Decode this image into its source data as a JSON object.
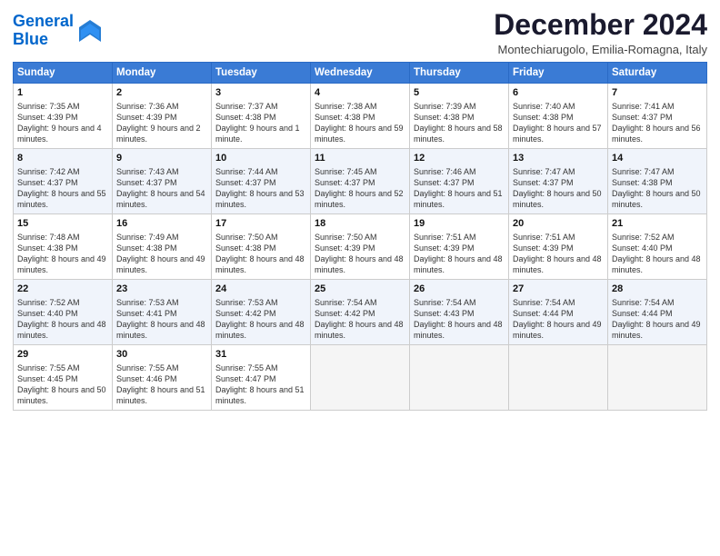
{
  "header": {
    "logo_line1": "General",
    "logo_line2": "Blue",
    "month_title": "December 2024",
    "location": "Montechiarugolo, Emilia-Romagna, Italy"
  },
  "days_of_week": [
    "Sunday",
    "Monday",
    "Tuesday",
    "Wednesday",
    "Thursday",
    "Friday",
    "Saturday"
  ],
  "weeks": [
    [
      {
        "day": 1,
        "sunrise": "7:35 AM",
        "sunset": "4:39 PM",
        "daylight": "9 hours and 4 minutes."
      },
      {
        "day": 2,
        "sunrise": "7:36 AM",
        "sunset": "4:39 PM",
        "daylight": "9 hours and 2 minutes."
      },
      {
        "day": 3,
        "sunrise": "7:37 AM",
        "sunset": "4:38 PM",
        "daylight": "9 hours and 1 minute."
      },
      {
        "day": 4,
        "sunrise": "7:38 AM",
        "sunset": "4:38 PM",
        "daylight": "8 hours and 59 minutes."
      },
      {
        "day": 5,
        "sunrise": "7:39 AM",
        "sunset": "4:38 PM",
        "daylight": "8 hours and 58 minutes."
      },
      {
        "day": 6,
        "sunrise": "7:40 AM",
        "sunset": "4:38 PM",
        "daylight": "8 hours and 57 minutes."
      },
      {
        "day": 7,
        "sunrise": "7:41 AM",
        "sunset": "4:37 PM",
        "daylight": "8 hours and 56 minutes."
      }
    ],
    [
      {
        "day": 8,
        "sunrise": "7:42 AM",
        "sunset": "4:37 PM",
        "daylight": "8 hours and 55 minutes."
      },
      {
        "day": 9,
        "sunrise": "7:43 AM",
        "sunset": "4:37 PM",
        "daylight": "8 hours and 54 minutes."
      },
      {
        "day": 10,
        "sunrise": "7:44 AM",
        "sunset": "4:37 PM",
        "daylight": "8 hours and 53 minutes."
      },
      {
        "day": 11,
        "sunrise": "7:45 AM",
        "sunset": "4:37 PM",
        "daylight": "8 hours and 52 minutes."
      },
      {
        "day": 12,
        "sunrise": "7:46 AM",
        "sunset": "4:37 PM",
        "daylight": "8 hours and 51 minutes."
      },
      {
        "day": 13,
        "sunrise": "7:47 AM",
        "sunset": "4:37 PM",
        "daylight": "8 hours and 50 minutes."
      },
      {
        "day": 14,
        "sunrise": "7:47 AM",
        "sunset": "4:38 PM",
        "daylight": "8 hours and 50 minutes."
      }
    ],
    [
      {
        "day": 15,
        "sunrise": "7:48 AM",
        "sunset": "4:38 PM",
        "daylight": "8 hours and 49 minutes."
      },
      {
        "day": 16,
        "sunrise": "7:49 AM",
        "sunset": "4:38 PM",
        "daylight": "8 hours and 49 minutes."
      },
      {
        "day": 17,
        "sunrise": "7:50 AM",
        "sunset": "4:38 PM",
        "daylight": "8 hours and 48 minutes."
      },
      {
        "day": 18,
        "sunrise": "7:50 AM",
        "sunset": "4:39 PM",
        "daylight": "8 hours and 48 minutes."
      },
      {
        "day": 19,
        "sunrise": "7:51 AM",
        "sunset": "4:39 PM",
        "daylight": "8 hours and 48 minutes."
      },
      {
        "day": 20,
        "sunrise": "7:51 AM",
        "sunset": "4:39 PM",
        "daylight": "8 hours and 48 minutes."
      },
      {
        "day": 21,
        "sunrise": "7:52 AM",
        "sunset": "4:40 PM",
        "daylight": "8 hours and 48 minutes."
      }
    ],
    [
      {
        "day": 22,
        "sunrise": "7:52 AM",
        "sunset": "4:40 PM",
        "daylight": "8 hours and 48 minutes."
      },
      {
        "day": 23,
        "sunrise": "7:53 AM",
        "sunset": "4:41 PM",
        "daylight": "8 hours and 48 minutes."
      },
      {
        "day": 24,
        "sunrise": "7:53 AM",
        "sunset": "4:42 PM",
        "daylight": "8 hours and 48 minutes."
      },
      {
        "day": 25,
        "sunrise": "7:54 AM",
        "sunset": "4:42 PM",
        "daylight": "8 hours and 48 minutes."
      },
      {
        "day": 26,
        "sunrise": "7:54 AM",
        "sunset": "4:43 PM",
        "daylight": "8 hours and 48 minutes."
      },
      {
        "day": 27,
        "sunrise": "7:54 AM",
        "sunset": "4:44 PM",
        "daylight": "8 hours and 49 minutes."
      },
      {
        "day": 28,
        "sunrise": "7:54 AM",
        "sunset": "4:44 PM",
        "daylight": "8 hours and 49 minutes."
      }
    ],
    [
      {
        "day": 29,
        "sunrise": "7:55 AM",
        "sunset": "4:45 PM",
        "daylight": "8 hours and 50 minutes."
      },
      {
        "day": 30,
        "sunrise": "7:55 AM",
        "sunset": "4:46 PM",
        "daylight": "8 hours and 51 minutes."
      },
      {
        "day": 31,
        "sunrise": "7:55 AM",
        "sunset": "4:47 PM",
        "daylight": "8 hours and 51 minutes."
      },
      null,
      null,
      null,
      null
    ]
  ]
}
